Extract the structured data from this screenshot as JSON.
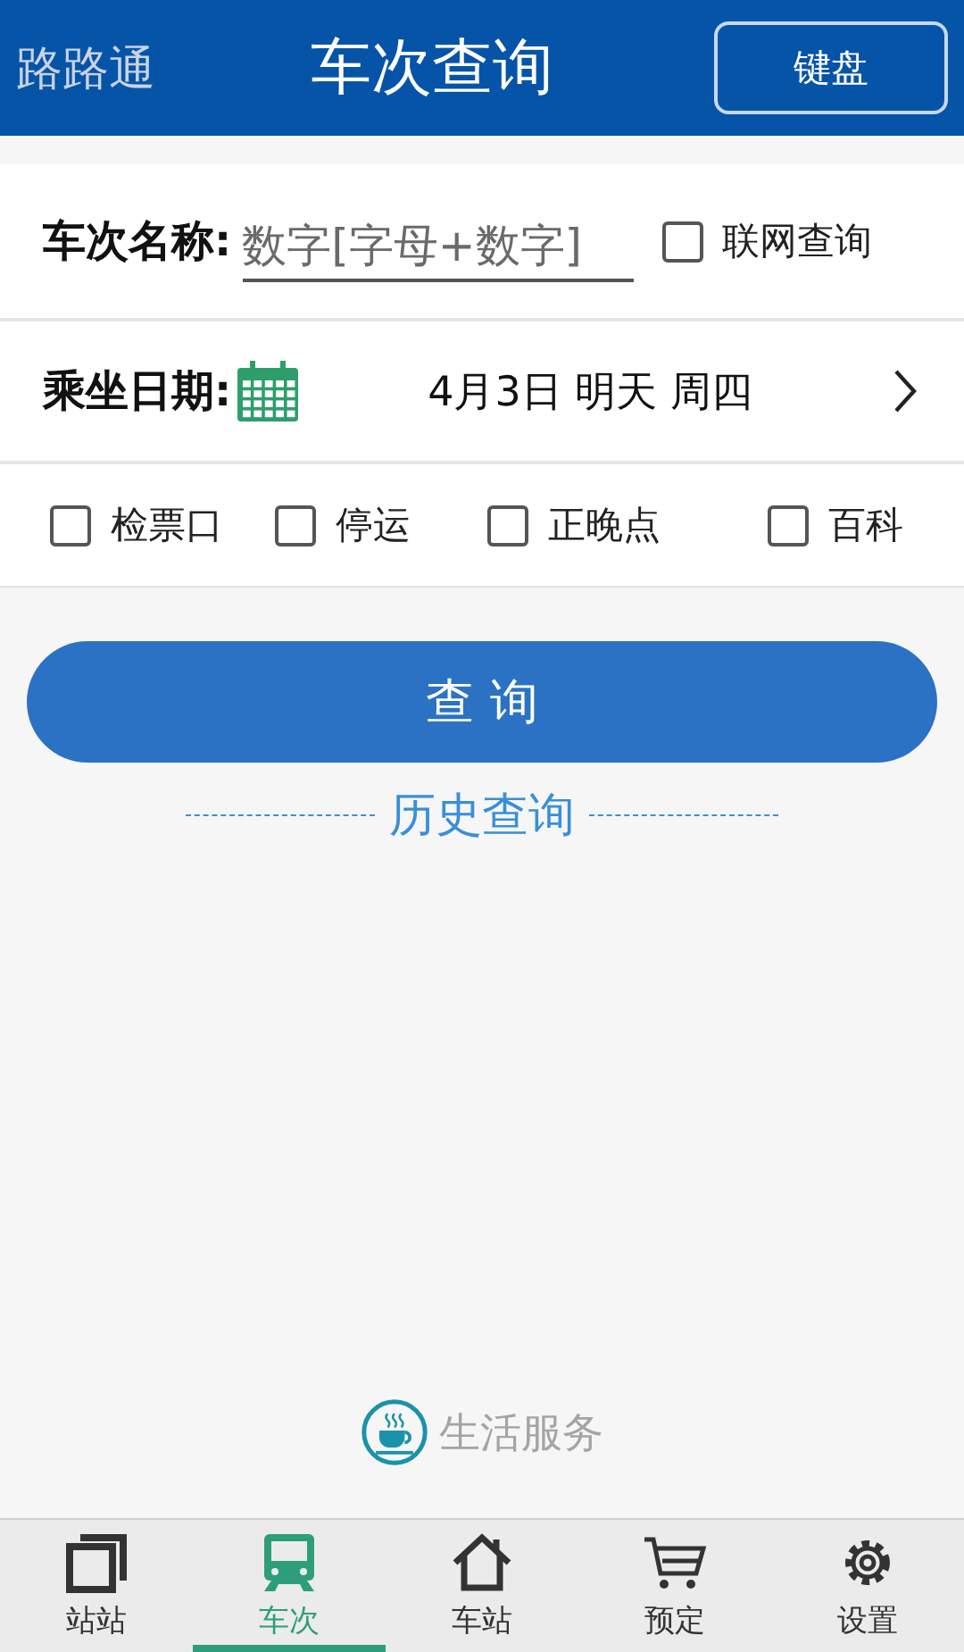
{
  "header": {
    "app_name": "路路通",
    "title": "车次查询",
    "keyboard_button": "键盘"
  },
  "train_field": {
    "label": "车次名称:",
    "placeholder": "数字[字母+数字]",
    "online": {
      "label": "联网查询",
      "checked": false
    }
  },
  "date_row": {
    "label": "乘坐日期:",
    "value": "4月3日 明天 周四"
  },
  "options": [
    {
      "label": "检票口",
      "checked": false
    },
    {
      "label": "停运",
      "checked": false
    },
    {
      "label": "正晚点",
      "checked": false
    },
    {
      "label": "百科",
      "checked": false
    }
  ],
  "query_button": "查 询",
  "history_link": "历史查询",
  "life_service": "生活服务",
  "tabs": [
    {
      "label": "站站",
      "kind": "windows",
      "selected": false
    },
    {
      "label": "车次",
      "kind": "train",
      "selected": true
    },
    {
      "label": "车站",
      "kind": "home",
      "selected": false
    },
    {
      "label": "预定",
      "kind": "cart",
      "selected": false
    },
    {
      "label": "设置",
      "kind": "gear",
      "selected": false
    }
  ]
}
